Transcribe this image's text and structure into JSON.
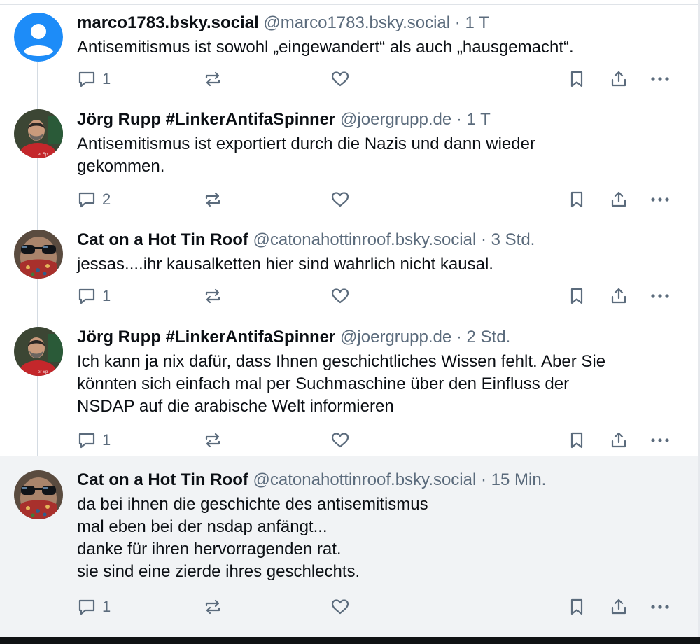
{
  "posts": [
    {
      "name": "marco1783.bsky.social",
      "handle": "@marco1783.bsky.social",
      "time": "1 T",
      "text": "Antisemitismus ist sowohl „eingewandert“ als auch „hausgemacht“.",
      "replies": "1",
      "avatar": "default-person-avatar"
    },
    {
      "name": "Jörg Rupp #LinkerAntifaSpinner",
      "handle": "@joergrupp.de",
      "time": "1 T",
      "text": "Antisemitismus ist exportiert durch die Nazis und dann wieder\ngekommen.",
      "replies": "2",
      "avatar": "bearded-man-photo"
    },
    {
      "name": "Cat on a Hot Tin Roof",
      "handle": "@catonahottinroof.bsky.social",
      "time": "3 Std.",
      "text": "jessas....ihr kausalketten hier sind wahrlich nicht kausal.",
      "replies": "1",
      "avatar": "sunglasses-mask-photo"
    },
    {
      "name": "Jörg Rupp #LinkerAntifaSpinner",
      "handle": "@joergrupp.de",
      "time": "2 Std.",
      "text": "Ich kann ja nix dafür, dass Ihnen geschichtliches Wissen fehlt. Aber Sie\nkönnten sich einfach mal per Suchmaschine über den Einfluss der\nNSDAP auf die arabische Welt informieren",
      "replies": "1",
      "avatar": "bearded-man-photo"
    },
    {
      "name": "Cat on a Hot Tin Roof",
      "handle": "@catonahottinroof.bsky.social",
      "time": "15 Min.",
      "text": "da bei ihnen die geschichte des antisemitismus\nmal eben bei der nsdap anfängt...\ndanke für ihren hervorragenden rat.\nsie sind eine zierde ihres geschlechts.",
      "replies": "1",
      "avatar": "sunglasses-mask-photo"
    }
  ],
  "separator": "·",
  "colors": {
    "default_avatar": "#1d8cf8",
    "secondary_text": "#5b6b7c",
    "icon": "#5b6b7c",
    "thread_line": "#d4dbe2",
    "highlight_bg": "#f1f3f5"
  },
  "icons": [
    "reply-icon",
    "repost-icon",
    "like-icon",
    "bookmark-icon",
    "share-icon",
    "more-icon"
  ]
}
